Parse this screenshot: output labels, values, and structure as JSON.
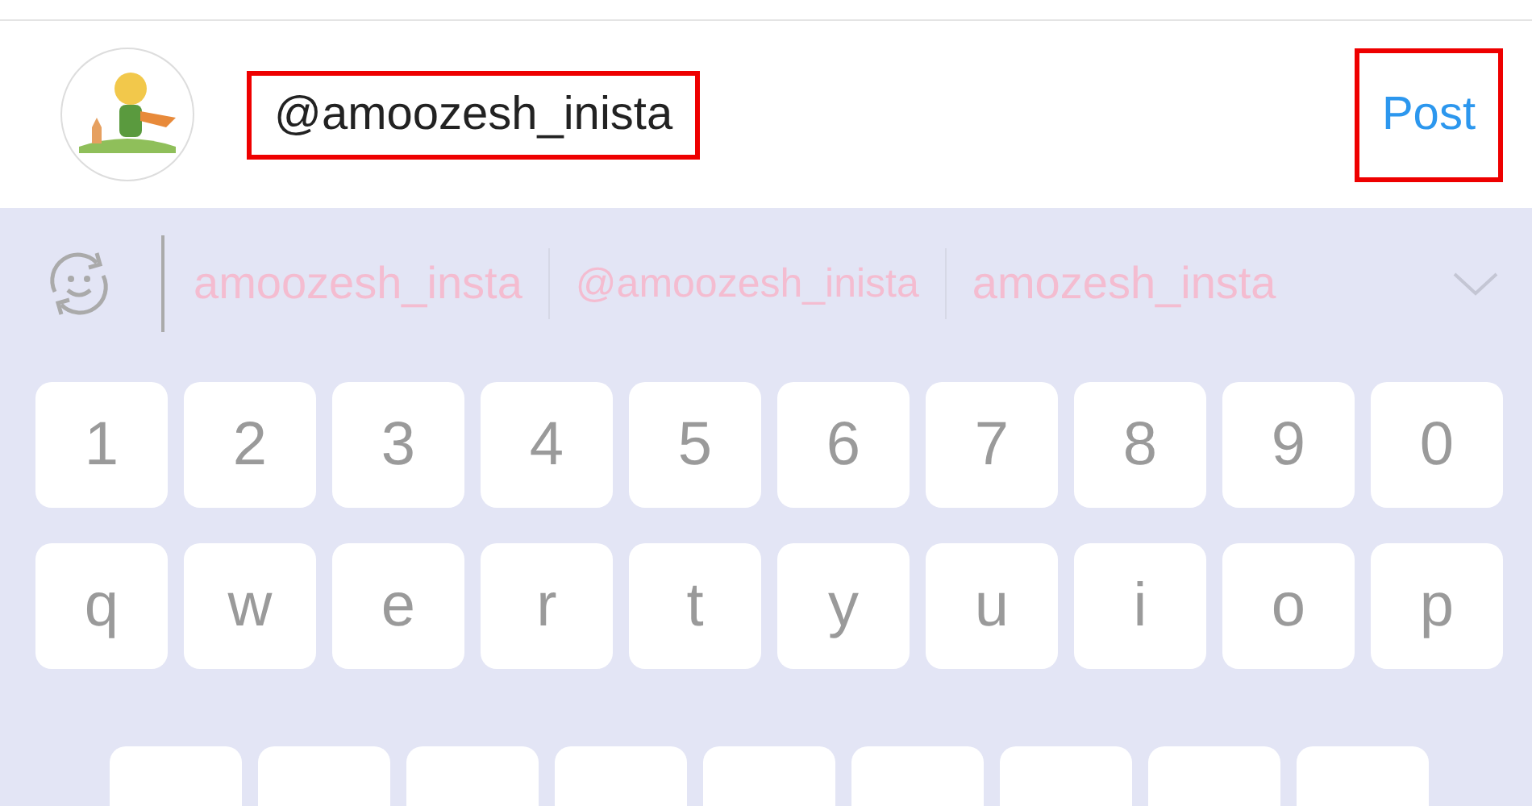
{
  "comment_bar": {
    "username_field": {
      "value": "@amoozesh_inista",
      "highlighted": true
    },
    "post_button": {
      "label": "Post",
      "highlighted": true
    }
  },
  "suggestion_bar": {
    "suggestions": [
      "amoozesh_insta",
      "@amoozesh_inista",
      "amozesh_insta"
    ]
  },
  "keyboard": {
    "rows": [
      {
        "keys": [
          {
            "kind": "char",
            "label": "1"
          },
          {
            "kind": "char",
            "label": "2"
          },
          {
            "kind": "char",
            "label": "3"
          },
          {
            "kind": "char",
            "label": "4"
          },
          {
            "kind": "char",
            "label": "5"
          },
          {
            "kind": "char",
            "label": "6"
          },
          {
            "kind": "char",
            "label": "7"
          },
          {
            "kind": "char",
            "label": "8"
          },
          {
            "kind": "char",
            "label": "9"
          },
          {
            "kind": "char",
            "label": "0"
          }
        ]
      },
      {
        "keys": [
          {
            "kind": "char",
            "label": "q"
          },
          {
            "kind": "char",
            "label": "w"
          },
          {
            "kind": "char",
            "label": "e"
          },
          {
            "kind": "char",
            "label": "r"
          },
          {
            "kind": "char",
            "label": "t"
          },
          {
            "kind": "char",
            "label": "y"
          },
          {
            "kind": "char",
            "label": "u"
          },
          {
            "kind": "char",
            "label": "i"
          },
          {
            "kind": "char",
            "label": "o"
          },
          {
            "kind": "char",
            "label": "p"
          }
        ]
      },
      {
        "keys": [
          {
            "kind": "blank"
          },
          {
            "kind": "blank"
          },
          {
            "kind": "blank"
          },
          {
            "kind": "blank"
          },
          {
            "kind": "blank"
          },
          {
            "kind": "blank"
          },
          {
            "kind": "blank"
          },
          {
            "kind": "blank"
          },
          {
            "kind": "blank"
          }
        ]
      }
    ]
  }
}
